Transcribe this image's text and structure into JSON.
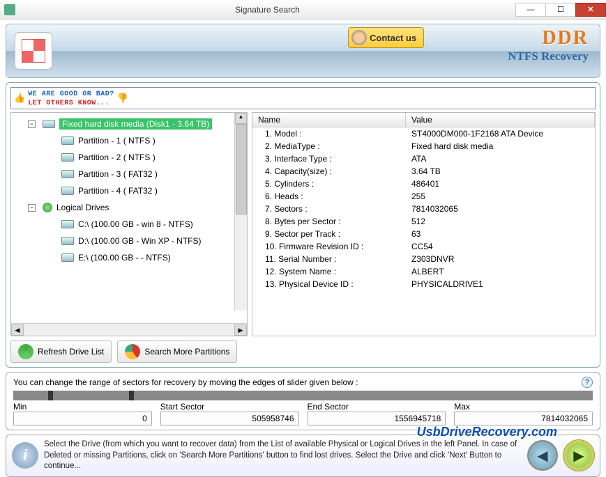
{
  "window": {
    "title": "Signature Search"
  },
  "header": {
    "contact_label": "Contact us",
    "brand": "DDR",
    "product": "NTFS Recovery"
  },
  "feedback": {
    "line1": "WE ARE GOOD OR BAD?",
    "line2": "LET OTHERS KNOW..."
  },
  "tree": {
    "root_label": "Fixed hard disk media (Disk1 - 3.64 TB)",
    "partitions": [
      "Partition - 1 ( NTFS )",
      "Partition - 2 ( NTFS )",
      "Partition - 3 ( FAT32 )",
      "Partition - 4 ( FAT32 )"
    ],
    "logical_label": "Logical Drives",
    "logical": [
      "C:\\ (100.00 GB - win 8 - NTFS)",
      "D:\\ (100.00 GB - Win XP - NTFS)",
      "E:\\ (100.00 GB -  - NTFS)"
    ]
  },
  "props": {
    "head_name": "Name",
    "head_value": "Value",
    "rows": [
      {
        "n": "1. Model :",
        "v": "ST4000DM000-1F2168 ATA Device"
      },
      {
        "n": "2. MediaType :",
        "v": "Fixed hard disk media"
      },
      {
        "n": "3. Interface Type :",
        "v": "ATA"
      },
      {
        "n": "4. Capacity(size) :",
        "v": "3.64 TB"
      },
      {
        "n": "5. Cylinders :",
        "v": "486401"
      },
      {
        "n": "6. Heads :",
        "v": "255"
      },
      {
        "n": "7. Sectors :",
        "v": "7814032065"
      },
      {
        "n": "8. Bytes per Sector :",
        "v": "512"
      },
      {
        "n": "9. Sector per Track :",
        "v": "63"
      },
      {
        "n": "10. Firmware Revision ID :",
        "v": "CC54"
      },
      {
        "n": "11. Serial Number :",
        "v": "Z303DNVR"
      },
      {
        "n": "12. System Name :",
        "v": "ALBERT"
      },
      {
        "n": "13. Physical Device ID :",
        "v": "PHYSICALDRIVE1"
      }
    ]
  },
  "buttons": {
    "refresh": "Refresh Drive List",
    "searchmore": "Search More Partitions"
  },
  "slider": {
    "desc": "You can change the range of sectors for recovery by moving the edges of slider given below :",
    "min_label": "Min",
    "min_val": "0",
    "start_label": "Start Sector",
    "start_val": "505958746",
    "end_label": "End Sector",
    "end_val": "1556945718",
    "max_label": "Max",
    "max_val": "7814032065"
  },
  "footer": {
    "text": "Select the Drive (from which you want to recover data) from the List of available Physical or Logical Drives in the left Panel. In case of Deleted or missing Partitions, click on 'Search More Partitions' button to find lost drives. Select the Drive and click 'Next' Button to continue..."
  },
  "watermark": "UsbDriveRecovery.com"
}
